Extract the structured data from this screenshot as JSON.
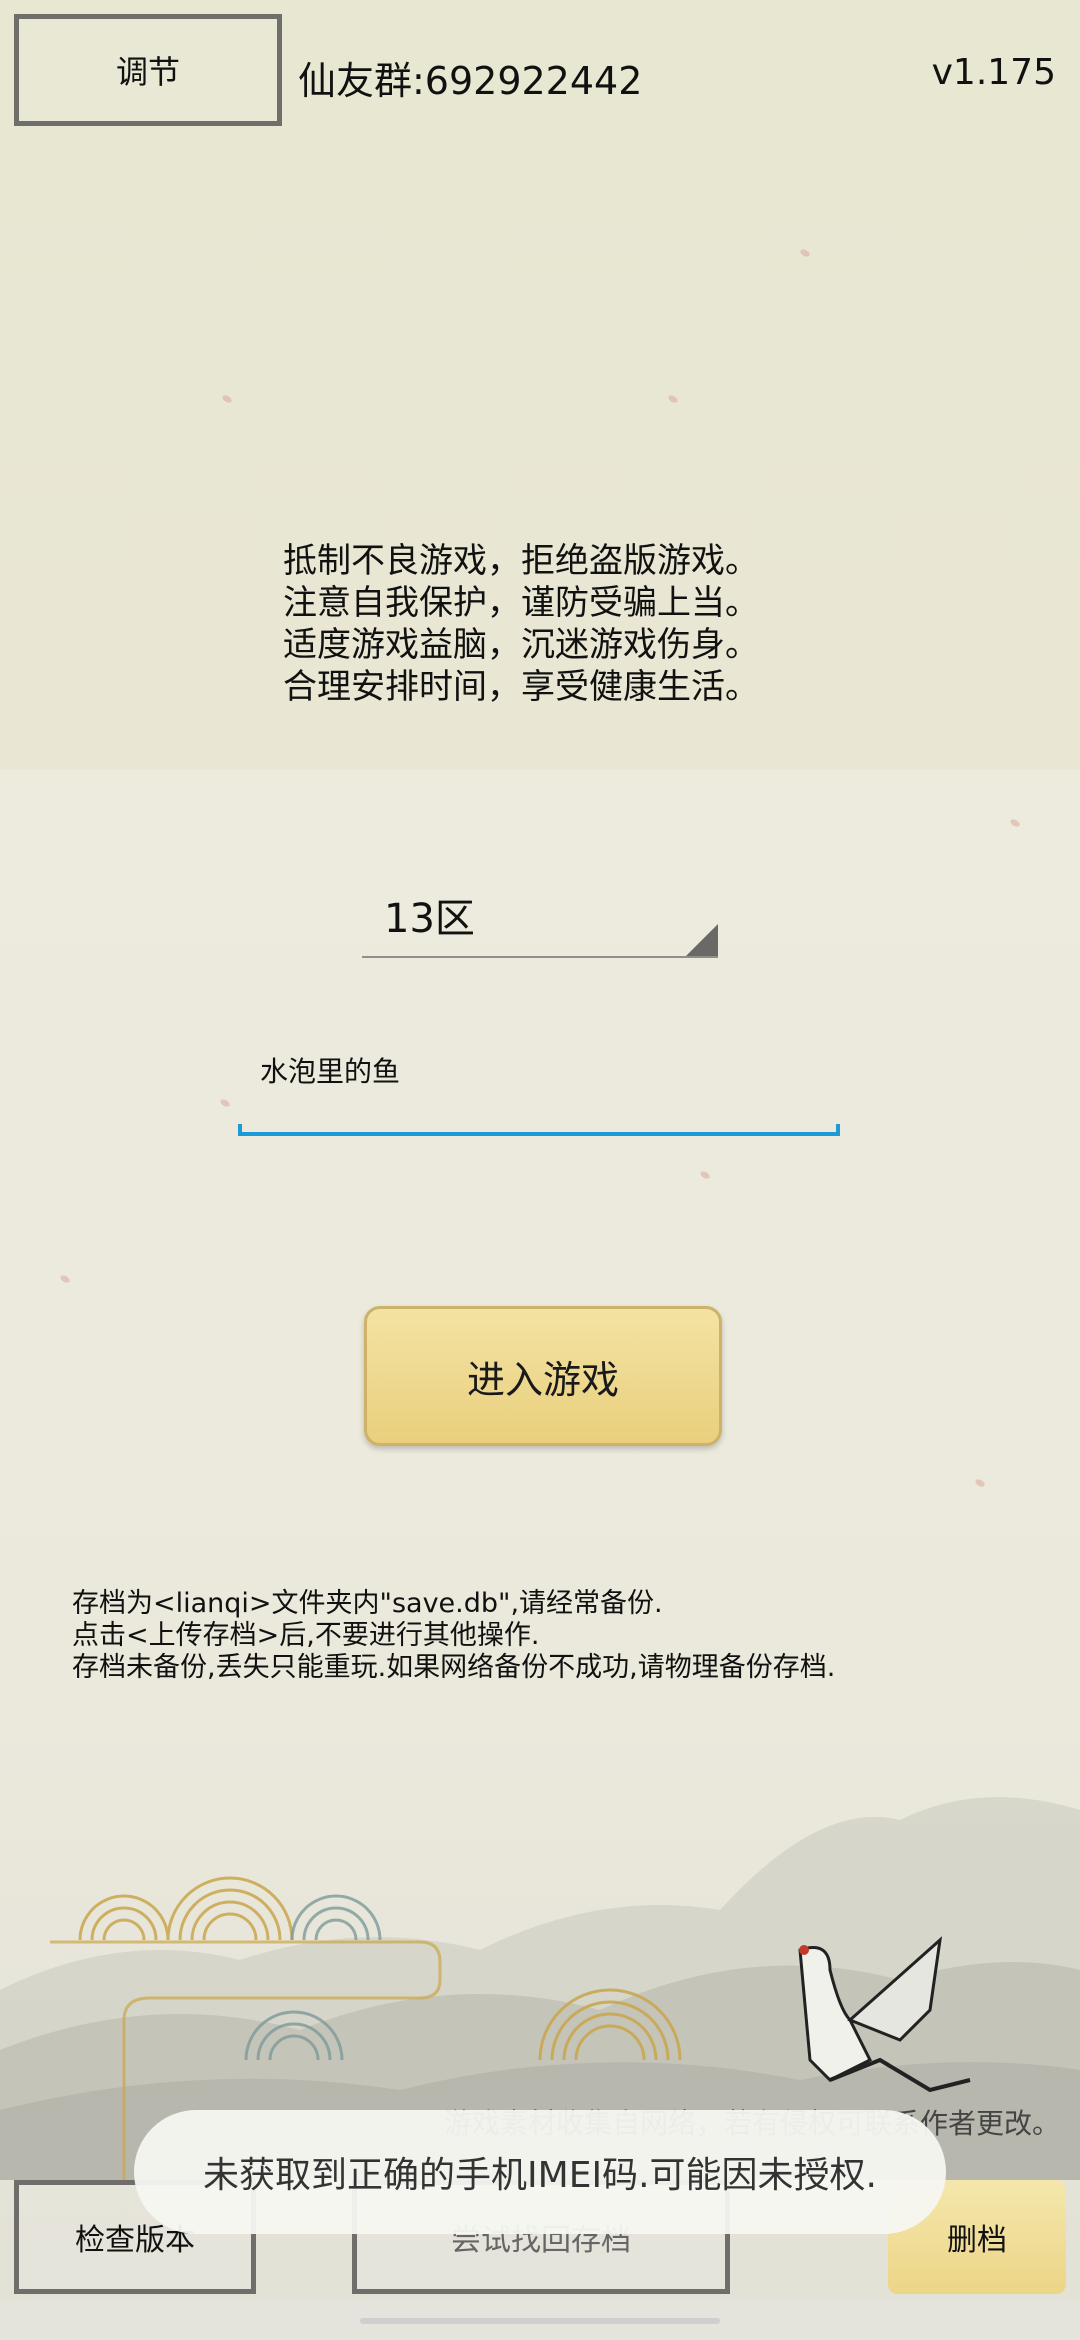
{
  "header": {
    "adjust_label": "调节",
    "qq_group": "仙友群:692922442",
    "version": "v1.175"
  },
  "notice": {
    "lines": [
      "抵制不良游戏，拒绝盗版游戏。",
      "注意自我保护，谨防受骗上当。",
      "适度游戏益脑，沉迷游戏伤身。",
      "合理安排时间，享受健康生活。"
    ]
  },
  "login": {
    "server_value": "13区",
    "name_value": "水泡里的鱼",
    "enter_label": "进入游戏",
    "accent": "#1b9ad6"
  },
  "save_info": {
    "lines": [
      "存档为<lianqi>文件夹内\"save.db\",请经常备份.",
      "点击<上传存档>后,不要进行其他操作.",
      "存档未备份,丢失只能重玩.如果网络备份不成功,请物理备份存档."
    ]
  },
  "credit": "游戏素材收集自网络，若有侵权可联系作者更改。",
  "bottom": {
    "check_label": "检查版本",
    "recover_label": "尝试找回存档",
    "delete_label": "删档"
  },
  "toast": "未获取到正确的手机IMEI码.可能因未授权."
}
